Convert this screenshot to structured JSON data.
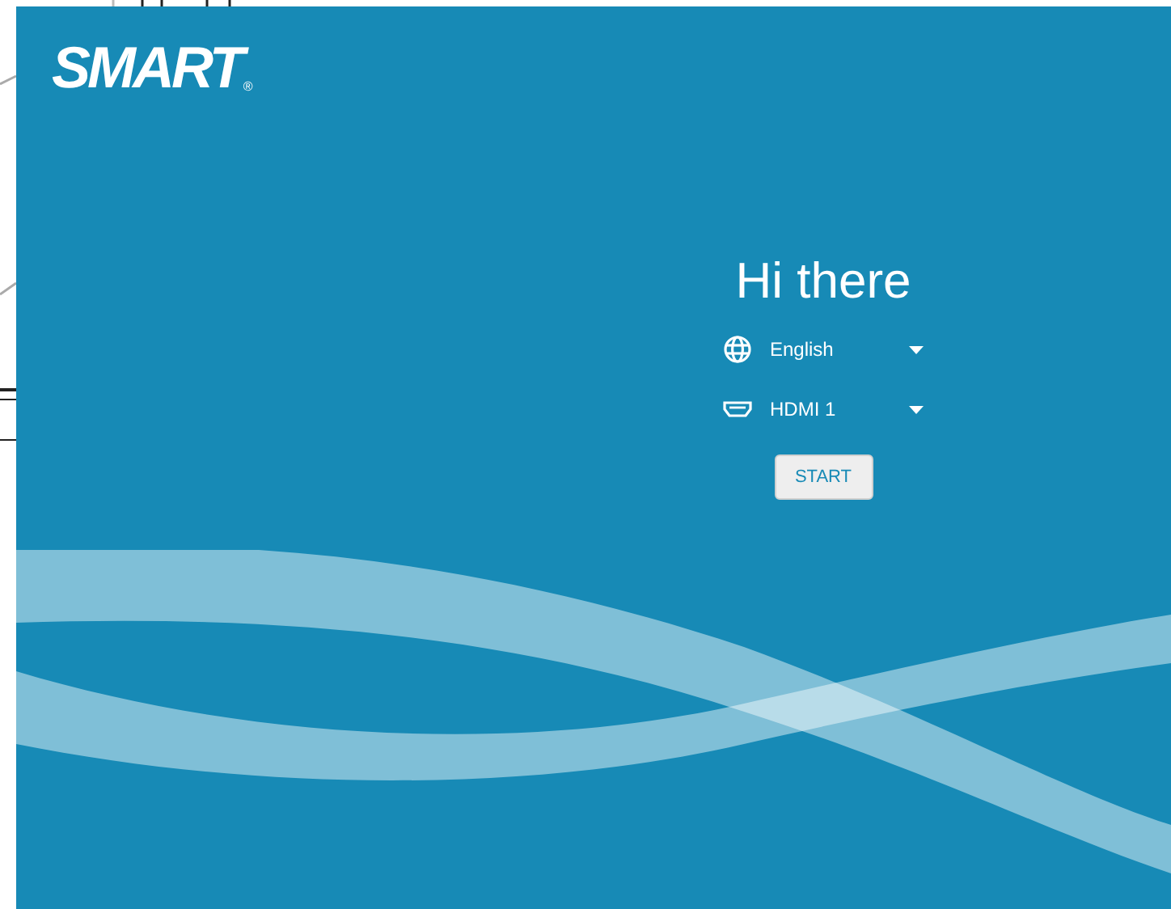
{
  "logo": {
    "text": "SMART",
    "mark": "®"
  },
  "greeting": "Hi there",
  "selects": [
    {
      "kind": "globe",
      "value": "English"
    },
    {
      "kind": "hdmi",
      "value": "HDMI 1"
    }
  ],
  "start_button": "START"
}
